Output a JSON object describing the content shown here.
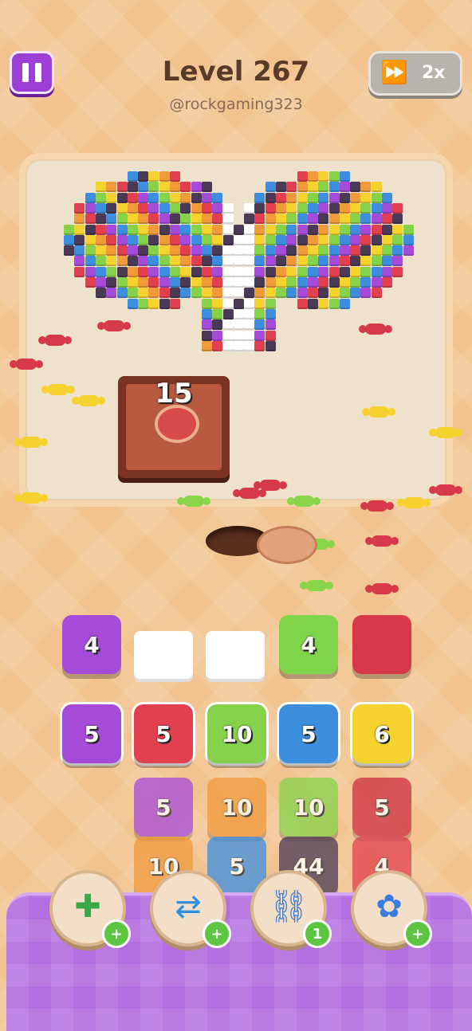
{
  "header": {
    "title": "Level 267",
    "subtitle": "@rockgaming323",
    "speed_label": "2x"
  },
  "board": {
    "crate_count": "15"
  },
  "queue_slots": [
    {
      "value": "4",
      "color": "#a64ad9",
      "filled": true
    },
    {
      "value": "",
      "color": "#ffffff",
      "filled": false
    },
    {
      "value": "",
      "color": "#ffffff",
      "filled": false
    },
    {
      "value": "4",
      "color": "#7fd44a",
      "filled": true
    },
    {
      "value": "",
      "color": "#d63a4a",
      "filled": true
    }
  ],
  "grid_rows": [
    [
      {
        "value": "5",
        "color": "#a64ad9"
      },
      {
        "value": "5",
        "color": "#e2404e"
      },
      {
        "value": "10",
        "color": "#86d24a"
      },
      {
        "value": "5",
        "color": "#3e8ee0"
      },
      {
        "value": "6",
        "color": "#f5d22e"
      }
    ],
    [
      {
        "value": "5",
        "color": "#a64ad9"
      },
      {
        "value": "10",
        "color": "#f19a3a"
      },
      {
        "value": "10",
        "color": "#86d24a"
      },
      {
        "value": "5",
        "color": "#cf2f3f"
      }
    ],
    [
      {
        "value": "10",
        "color": "#f19a3a"
      },
      {
        "value": "5",
        "color": "#3e8ee0"
      },
      {
        "value": "44",
        "color": "#4a3a55"
      },
      {
        "value": "4",
        "color": "#e2404e"
      }
    ]
  ],
  "powerups": [
    {
      "name": "add-tray",
      "badge": "+"
    },
    {
      "name": "shuffle",
      "badge": "+"
    },
    {
      "name": "magnet",
      "badge": "1"
    },
    {
      "name": "bomb",
      "badge": "+"
    }
  ]
}
